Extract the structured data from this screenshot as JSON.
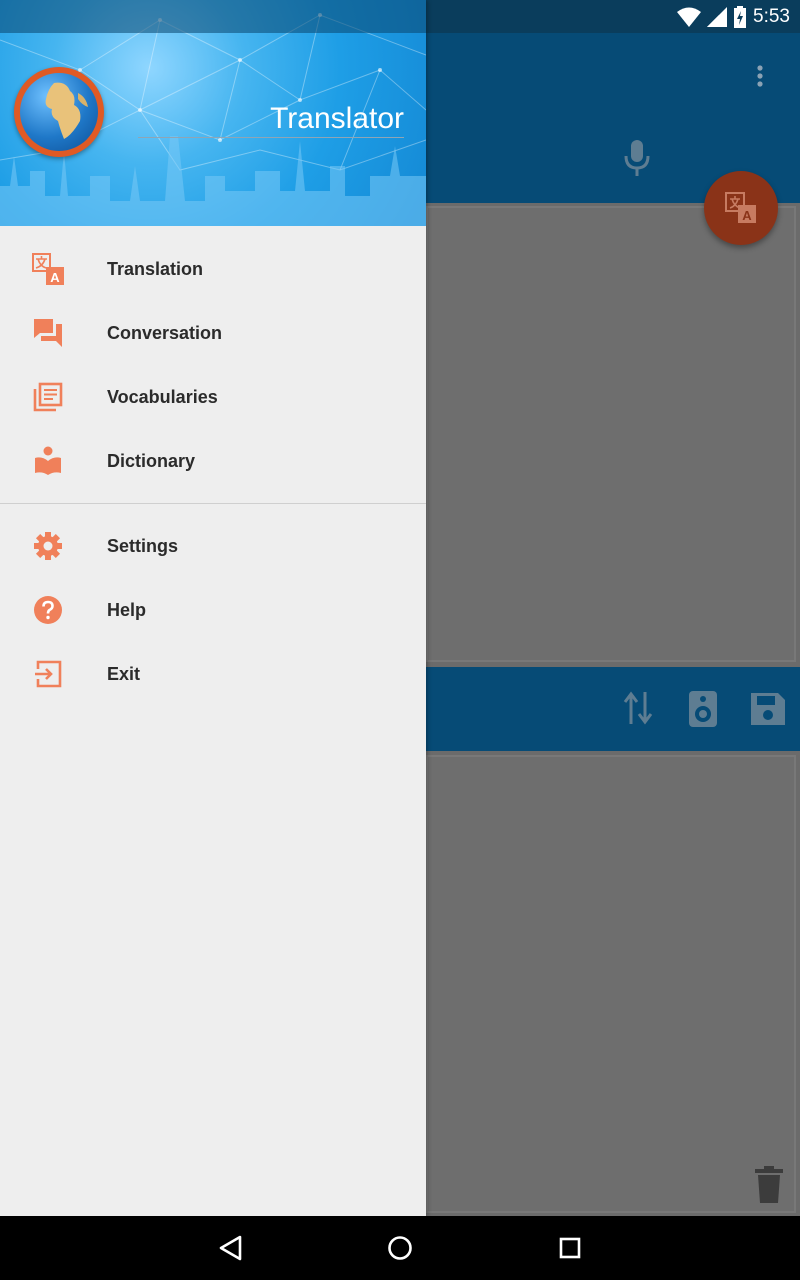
{
  "status_bar": {
    "time": "5:53"
  },
  "drawer": {
    "title": "Translator",
    "primary_items": [
      {
        "label": "Translation",
        "icon": "translate-icon"
      },
      {
        "label": "Conversation",
        "icon": "chat-icon"
      },
      {
        "label": "Vocabularies",
        "icon": "library-icon"
      },
      {
        "label": "Dictionary",
        "icon": "book-icon"
      }
    ],
    "secondary_items": [
      {
        "label": "Settings",
        "icon": "gear-icon"
      },
      {
        "label": "Help",
        "icon": "help-icon"
      },
      {
        "label": "Exit",
        "icon": "exit-icon"
      }
    ]
  },
  "colors": {
    "accent": "#f0805a",
    "toolbar": "#064b76",
    "drawer_bg": "#eeeeee",
    "fab": "#8a3318"
  }
}
